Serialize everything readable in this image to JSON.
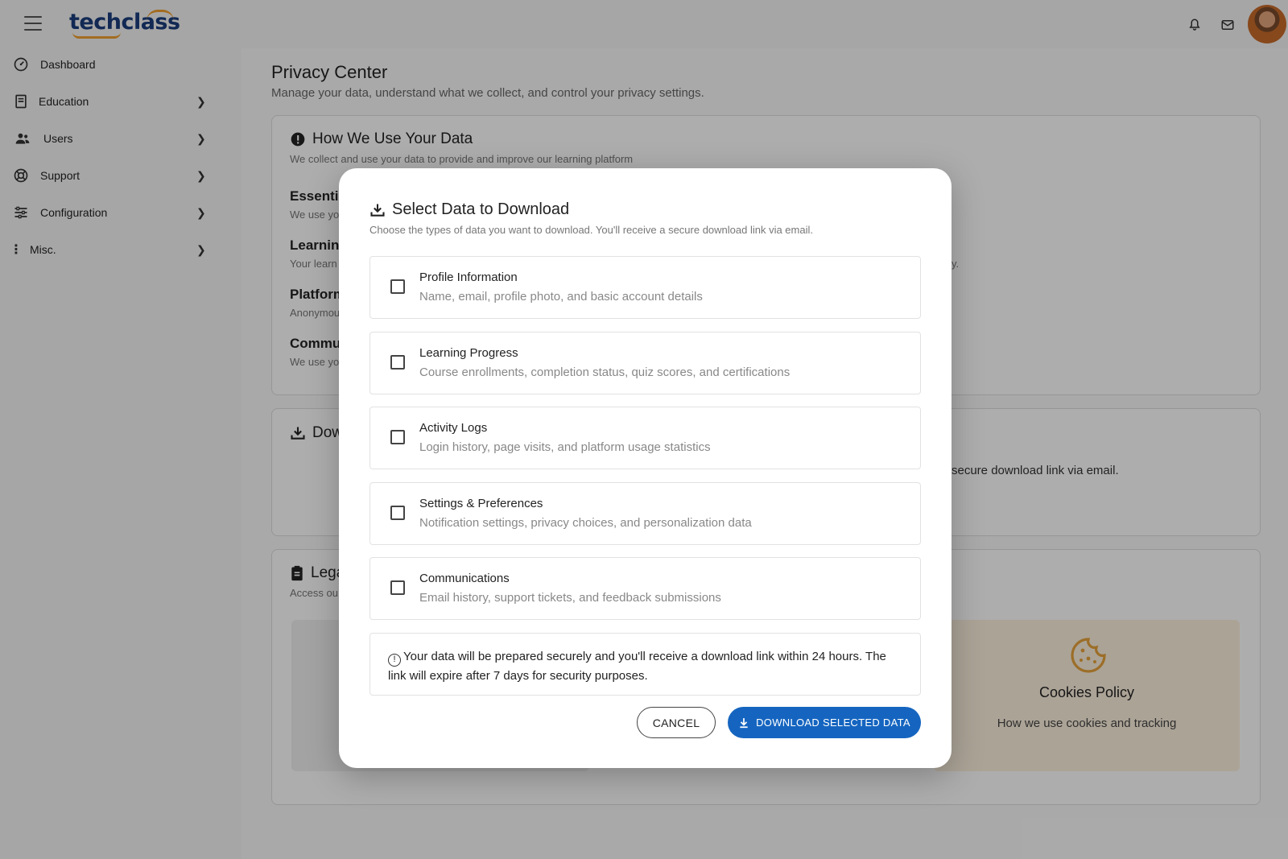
{
  "brand": {
    "logo_text": "techclass",
    "accent": "#f0a030",
    "primary": "#1a3d7c"
  },
  "sidebar": {
    "items": [
      {
        "label": "Dashboard",
        "icon": "dashboard-icon",
        "has_chevron": false
      },
      {
        "label": "Education",
        "icon": "book-icon",
        "has_chevron": true
      },
      {
        "label": "Users",
        "icon": "users-icon",
        "has_chevron": true
      },
      {
        "label": "Support",
        "icon": "lifebuoy-icon",
        "has_chevron": true
      },
      {
        "label": "Configuration",
        "icon": "sliders-icon",
        "has_chevron": true
      },
      {
        "label": "Misc.",
        "icon": "more-vertical-icon",
        "has_chevron": true
      }
    ]
  },
  "page": {
    "title": "Privacy Center",
    "subtitle": "Manage your data, understand what we collect, and control your privacy settings."
  },
  "usage_card": {
    "title": "How We Use Your Data",
    "subtitle": "We collect and use your data to provide and improve our learning platform",
    "items": [
      {
        "title": "Essenti",
        "sub": "We use yo"
      },
      {
        "title": "Learning",
        "sub": "Your learn"
      },
      {
        "title": "Platform",
        "sub": "Anonymou"
      },
      {
        "title": "Commu",
        "sub": "We use yo"
      }
    ],
    "trailing_fragment": "y."
  },
  "download_card": {
    "title": "Dow",
    "trailing_text": "secure download link via email."
  },
  "legal_card": {
    "title": "Lega",
    "subtitle": "Access ou",
    "cookies": {
      "title": "Cookies Policy",
      "subtitle": "How we use cookies and tracking",
      "color": "#e6a23c"
    }
  },
  "modal": {
    "title": "Select Data to Download",
    "subtitle": "Choose the types of data you want to download. You'll receive a secure download link via email.",
    "options": [
      {
        "title": "Profile Information",
        "desc": "Name, email, profile photo, and basic account details",
        "checked": false
      },
      {
        "title": "Learning Progress",
        "desc": "Course enrollments, completion status, quiz scores, and certifications",
        "checked": false
      },
      {
        "title": "Activity Logs",
        "desc": "Login history, page visits, and platform usage statistics",
        "checked": false
      },
      {
        "title": "Settings & Preferences",
        "desc": "Notification settings, privacy choices, and personalization data",
        "checked": false
      },
      {
        "title": "Communications",
        "desc": "Email history, support tickets, and feedback submissions",
        "checked": false
      }
    ],
    "notice": "Your data will be prepared securely and you'll receive a download link within 24 hours. The link will expire after 7 days for security purposes.",
    "cancel_label": "CANCEL",
    "download_label": "DOWNLOAD SELECTED DATA",
    "download_color": "#1565c0"
  }
}
